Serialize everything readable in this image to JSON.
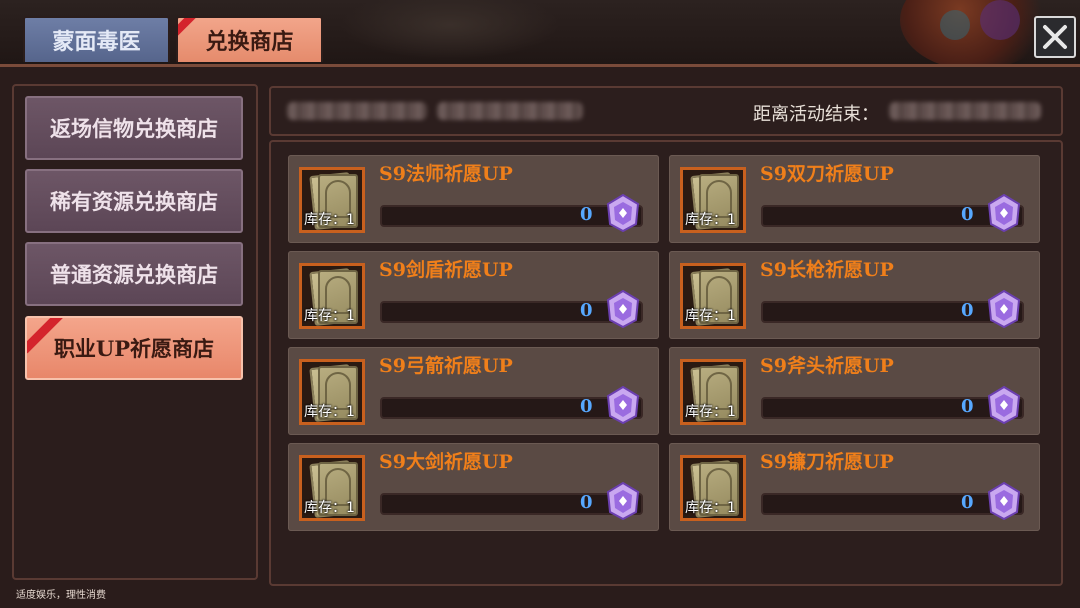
{
  "top_tabs": [
    {
      "label": "蒙面毒医",
      "active": false
    },
    {
      "label": "兑换商店",
      "active": true
    }
  ],
  "sidebar": {
    "items": [
      {
        "label": "返场信物兑换商店",
        "active": false
      },
      {
        "label": "稀有资源兑换商店",
        "active": false
      },
      {
        "label": "普通资源兑换商店",
        "active": false
      },
      {
        "label": "职业UP祈愿商店",
        "active": true
      }
    ]
  },
  "info": {
    "timer_label": "距离活动结束："
  },
  "products": [
    {
      "title": "S9法师祈愿UP",
      "stock": "库存：1",
      "amount": "0",
      "progress": 0
    },
    {
      "title": "S9双刀祈愿UP",
      "stock": "库存：1",
      "amount": "0",
      "progress": 0
    },
    {
      "title": "S9剑盾祈愿UP",
      "stock": "库存：1",
      "amount": "0",
      "progress": 0
    },
    {
      "title": "S9长枪祈愿UP",
      "stock": "库存：1",
      "amount": "0",
      "progress": 0
    },
    {
      "title": "S9弓箭祈愿UP",
      "stock": "库存：1",
      "amount": "0",
      "progress": 0
    },
    {
      "title": "S9斧头祈愿UP",
      "stock": "库存：1",
      "amount": "0",
      "progress": 0
    },
    {
      "title": "S9大剑祈愿UP",
      "stock": "库存：1",
      "amount": "0",
      "progress": 0
    },
    {
      "title": "S9镰刀祈愿UP",
      "stock": "库存：1",
      "amount": "0",
      "progress": 0
    }
  ],
  "footer": {
    "note": "适度娱乐，理性消费"
  },
  "icons": {
    "close": "close-icon",
    "currency": "purple-gem-icon",
    "product": "card-pack-icon"
  },
  "colors": {
    "active_tab": "#e58b6c",
    "inactive_tab": "#56658c",
    "title_orange": "#f07f1a",
    "value_blue": "#57a8ff",
    "ribbon_red": "#d4242c"
  }
}
